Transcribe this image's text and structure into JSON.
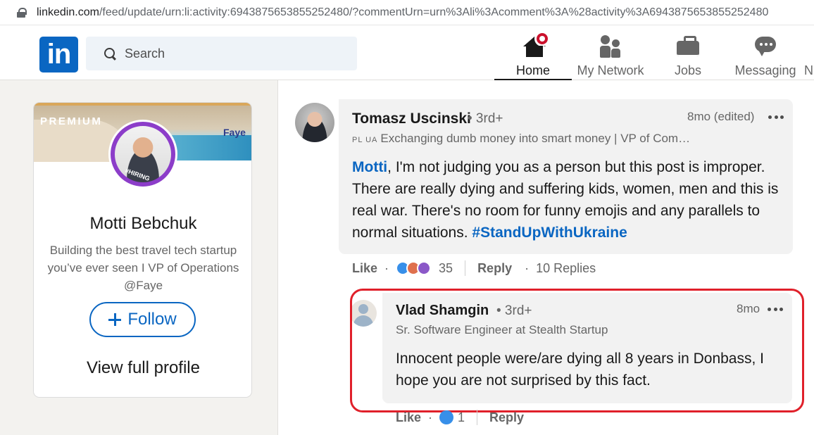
{
  "browser": {
    "url_host": "linkedin.com",
    "url_path": "/feed/update/urn:li:activity:6943875653855252480/?commentUrn=urn%3Ali%3Acomment%3A%28activity%3A6943875653855252480"
  },
  "header": {
    "logo_text": "in",
    "search_placeholder": "Search",
    "nav": [
      {
        "label": "Home",
        "icon": "home-icon",
        "active": true,
        "badge": "notification-dot"
      },
      {
        "label": "My Network",
        "icon": "people-icon"
      },
      {
        "label": "Jobs",
        "icon": "briefcase-icon"
      },
      {
        "label": "Messaging",
        "icon": "chat-bubble-icon"
      },
      {
        "label": "N",
        "icon": "bell-icon"
      }
    ]
  },
  "profile_card": {
    "premium_label": "PREMIUM",
    "banner_brand": "Faye",
    "avatar_frame_label": "#HIRING",
    "name": "Motti Bebchuk",
    "headline": "Building the best travel tech startup you’ve ever seen I VP of Operations @Faye",
    "follow_label": "Follow",
    "view_profile_label": "View full profile"
  },
  "comments": [
    {
      "author": "Tomasz Uscinski",
      "degree": "• 3rd+",
      "time": "8mo (edited)",
      "flags": "PL UA",
      "subtitle": "Exchanging dumb money into smart money | VP of Com…",
      "mention": "Motti",
      "body": ", I'm not judging you as a person but this post is improper. There are really dying and suffering kids, women, men and this is real war. There's no room for funny emojis and any parallels to normal situations. ",
      "hashtag": "#StandUpWithUkraine",
      "like_label": "Like",
      "reaction_count": "35",
      "reply_label": "Reply",
      "replies_label": "10 Replies"
    },
    {
      "author": "Vlad Shamgin",
      "degree": "• 3rd+",
      "time": "8mo",
      "subtitle": "Sr. Software Engineer at Stealth Startup",
      "body": "Innocent people were/are dying all 8 years in Donbass, I hope you are not surprised by this fact.",
      "like_label": "Like",
      "reaction_count": "1",
      "reply_label": "Reply"
    }
  ],
  "colors": {
    "brand": "#0a66c2",
    "highlight": "#e0202a",
    "badge": "#cb112d",
    "premium_frame": "#8c3dc9"
  }
}
